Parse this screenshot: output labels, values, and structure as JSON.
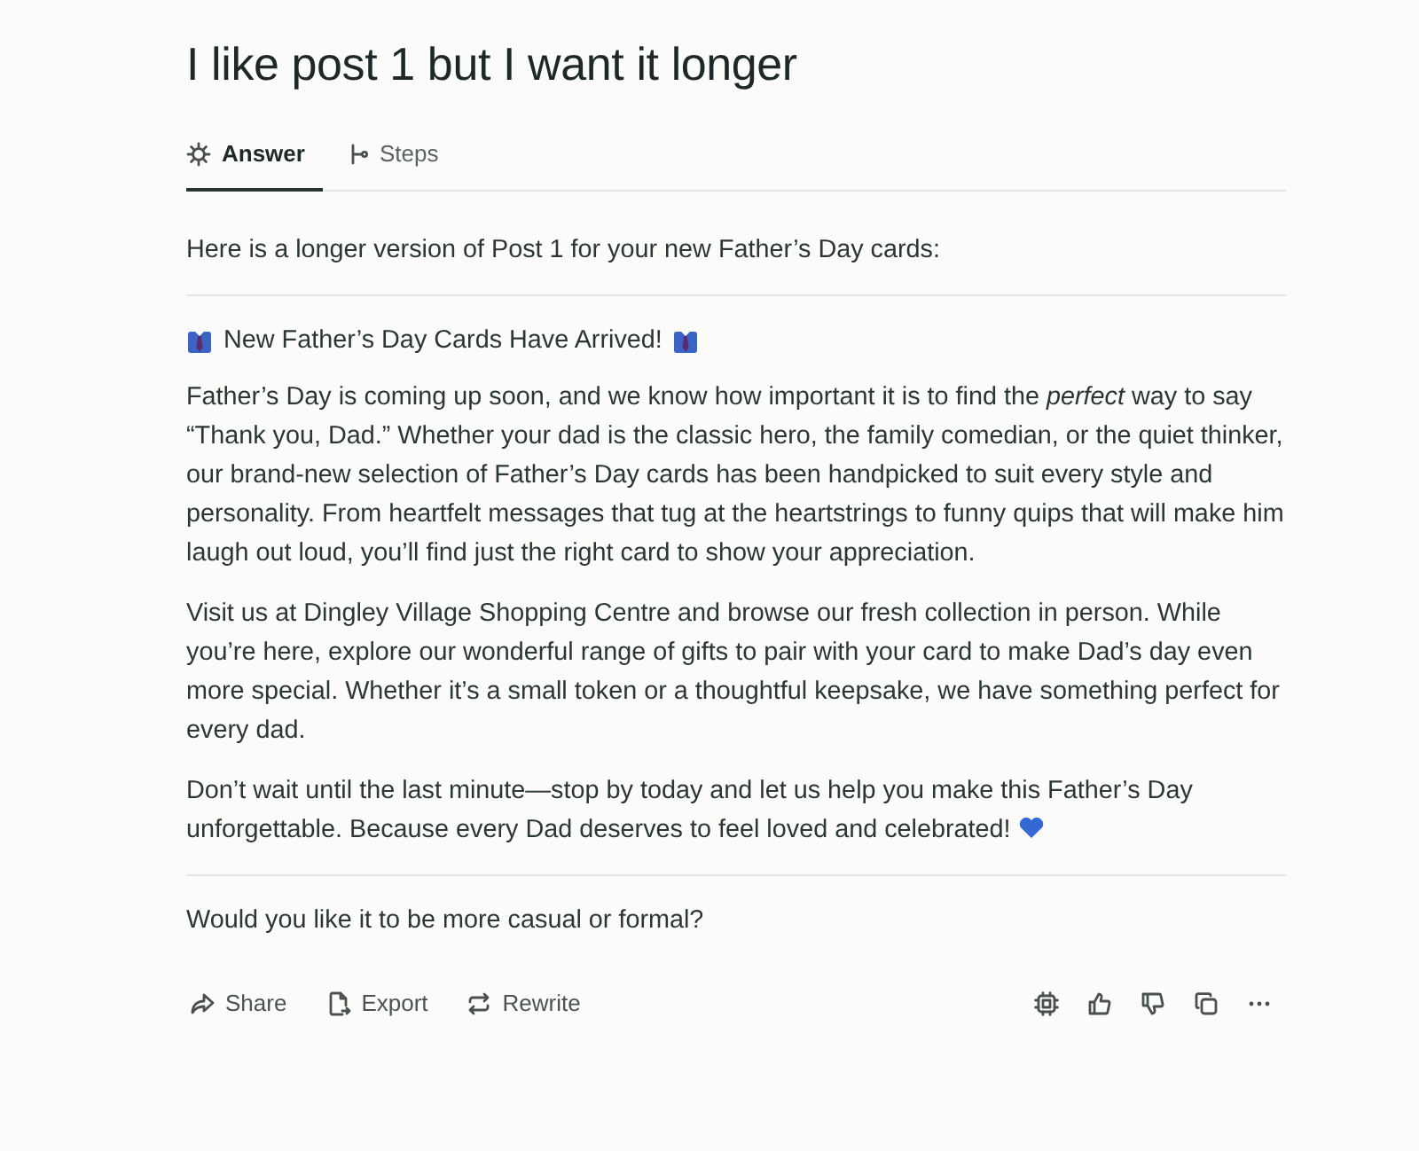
{
  "title": "I like post 1 but I want it longer",
  "tabs": [
    {
      "label": "Answer",
      "kind": "answer",
      "selected": true
    },
    {
      "label": "Steps",
      "kind": "steps",
      "selected": false
    }
  ],
  "intro": "Here is a longer version of Post 1 for your new Father’s Day cards:",
  "post": {
    "heading": "New Father’s Day Cards Have Arrived!",
    "paragraphs": [
      "Father’s Day is coming up soon, and we know how important it is to find the *perfect* way to say “Thank you, Dad.” Whether your dad is the classic hero, the family comedian, or the quiet thinker, our brand-new selection of Father’s Day cards has been handpicked to suit every style and personality. From heartfelt messages that tug at the heartstrings to funny quips that will make him laugh out loud, you’ll find just the right card to show your appreciation.",
      "Visit us at Dingley Village Shopping Centre and browse our fresh collection in person. While you’re here, explore our wonderful range of gifts to pair with your card to make Dad’s day even more special. Whether it’s a small token or a thoughtful keepsake, we have something perfect for every dad.",
      "Don’t wait until the last minute—stop by today and let us help you make this Father’s Day unforgettable. Because every Dad deserves to feel loved and celebrated!"
    ]
  },
  "question": "Would you like it to be more casual or formal?",
  "actions": [
    {
      "label": "Share",
      "kind": "share"
    },
    {
      "label": "Export",
      "kind": "export"
    },
    {
      "label": "Rewrite",
      "kind": "rewrite"
    }
  ],
  "tools": [
    {
      "kind": "chip"
    },
    {
      "kind": "like"
    },
    {
      "kind": "dislike"
    },
    {
      "kind": "copy"
    },
    {
      "kind": "more"
    }
  ]
}
